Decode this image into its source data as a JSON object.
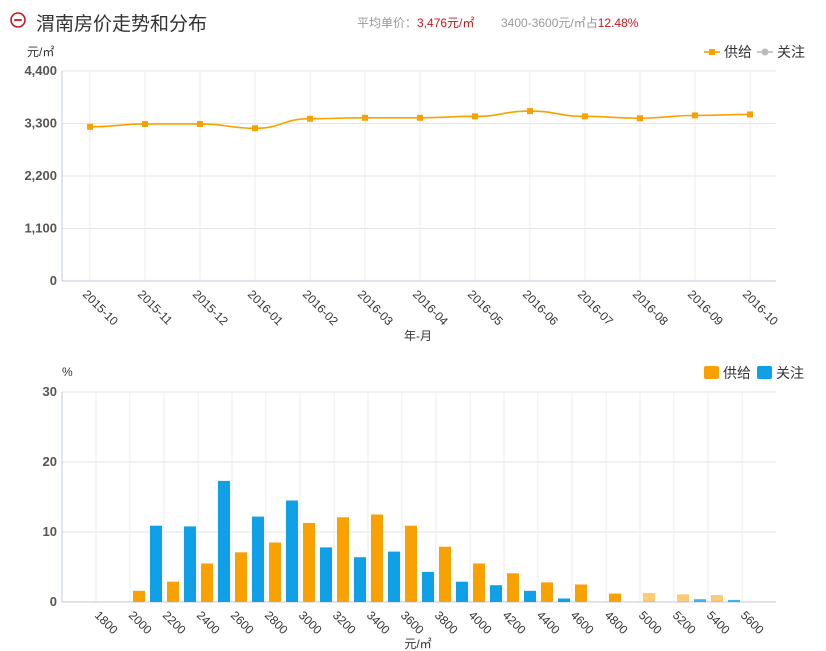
{
  "header": {
    "title": "渭南房价走势和分布",
    "avg_label": "平均单价：",
    "avg_value": "3,476元/㎡",
    "range_label": "3400-3600元/㎡占",
    "range_value": "12.48%"
  },
  "colors": {
    "supply": "#f9a100",
    "attention": "#0fa0e8",
    "attention_line": "#bbbbbb",
    "title_icon": "#c8161d"
  },
  "chart_data": [
    {
      "type": "line",
      "ylabel": "元/㎡",
      "xlabel": "年-月",
      "ylim": [
        0,
        4400
      ],
      "yticks": [
        0,
        1100,
        2200,
        3300,
        4400
      ],
      "ytick_labels": [
        "0",
        "1,100",
        "2,200",
        "3,300",
        "4,400"
      ],
      "categories": [
        "2015-10",
        "2015-11",
        "2015-12",
        "2016-01",
        "2016-02",
        "2016-03",
        "2016-04",
        "2016-05",
        "2016-06",
        "2016-07",
        "2016-08",
        "2016-09",
        "2016-10"
      ],
      "series": [
        {
          "name": "供给",
          "values": [
            3230,
            3290,
            3290,
            3200,
            3400,
            3420,
            3420,
            3450,
            3560,
            3450,
            3410,
            3470,
            3490
          ]
        },
        {
          "name": "关注",
          "values": []
        }
      ],
      "legend": "top-right",
      "grid": true
    },
    {
      "type": "bar",
      "ylabel": "%",
      "xlabel": "元/㎡",
      "ylim": [
        0,
        30
      ],
      "yticks": [
        0,
        10,
        20,
        30
      ],
      "categories": [
        "1800",
        "2000",
        "2200",
        "2400",
        "2600",
        "2800",
        "3000",
        "3200",
        "3400",
        "3600",
        "3800",
        "4000",
        "4200",
        "4400",
        "4600",
        "4800",
        "5000",
        "5200",
        "5400",
        "5600"
      ],
      "series": [
        {
          "name": "供给",
          "values": [
            0,
            1.6,
            2.9,
            5.5,
            7.1,
            8.5,
            11.3,
            12.1,
            12.5,
            10.9,
            7.9,
            5.5,
            4.1,
            2.8,
            2.5,
            1.2,
            1.3,
            1.1,
            1.0,
            0
          ]
        },
        {
          "name": "关注",
          "values": [
            0,
            10.9,
            10.8,
            17.3,
            12.2,
            14.5,
            7.8,
            6.4,
            7.2,
            4.3,
            2.9,
            2.4,
            1.6,
            0.5,
            0,
            0,
            0,
            0.4,
            0.3,
            0
          ]
        }
      ],
      "legend": "top-right",
      "grid": true
    }
  ]
}
